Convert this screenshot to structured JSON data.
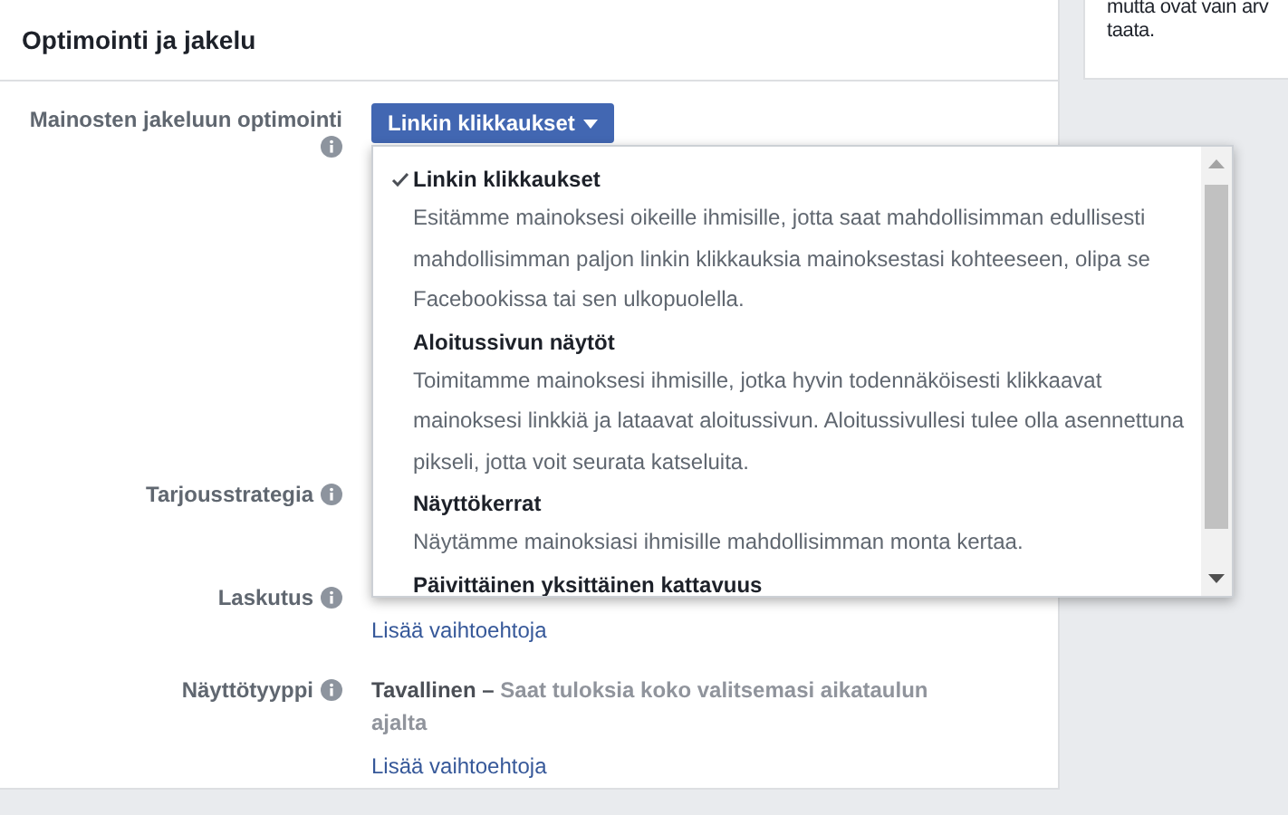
{
  "main_card": {
    "title": "Optimointi ja jakelu"
  },
  "side_note": {
    "lines": [
      "mutta ovat vain arv",
      "taata."
    ]
  },
  "fields": [
    {
      "kind": "dropdown",
      "label": "Mainosten jakeluun optimointi",
      "button": "Linkin klikkaukset",
      "menu": {
        "expanded": true,
        "options": [
          {
            "title": "Linkin klikkaukset",
            "selected": true,
            "description": "Esitämme mainoksesi oikeille ihmisille, jotta saat mahdollisimman edullisesti mahdollisimman paljon linkin klikkauksia mainoksestasi kohteeseen, olipa se Facebookissa tai sen ulkopuolella."
          },
          {
            "title": "Aloitussivun näytöt",
            "selected": false,
            "description": "Toimitamme mainoksesi ihmisille, jotka hyvin todennäköisesti klikkaavat mainoksesi linkkiä ja lataavat aloitussivun. Aloitussivullesi tulee olla asennettuna pikseli, jotta voit seurata katseluita."
          },
          {
            "title": "Näyttökerrat",
            "selected": false,
            "description": "Näytämme mainoksiasi ihmisille mahdollisimman monta kertaa."
          },
          {
            "title": "Päivittäinen yksittäinen kattavuus",
            "selected": false
          }
        ]
      }
    },
    {
      "kind": "plain",
      "label": "Tarjousstrategia"
    },
    {
      "kind": "link",
      "label": "Laskutus",
      "link": "Lisää vaihtoehtoja"
    },
    {
      "kind": "value",
      "label": "Näyttötyyppi",
      "value": "Tavallinen –",
      "description": "Saat tuloksia koko valitsemasi aikataulun ajalta",
      "link": "Lisää vaihtoehtoja"
    }
  ]
}
